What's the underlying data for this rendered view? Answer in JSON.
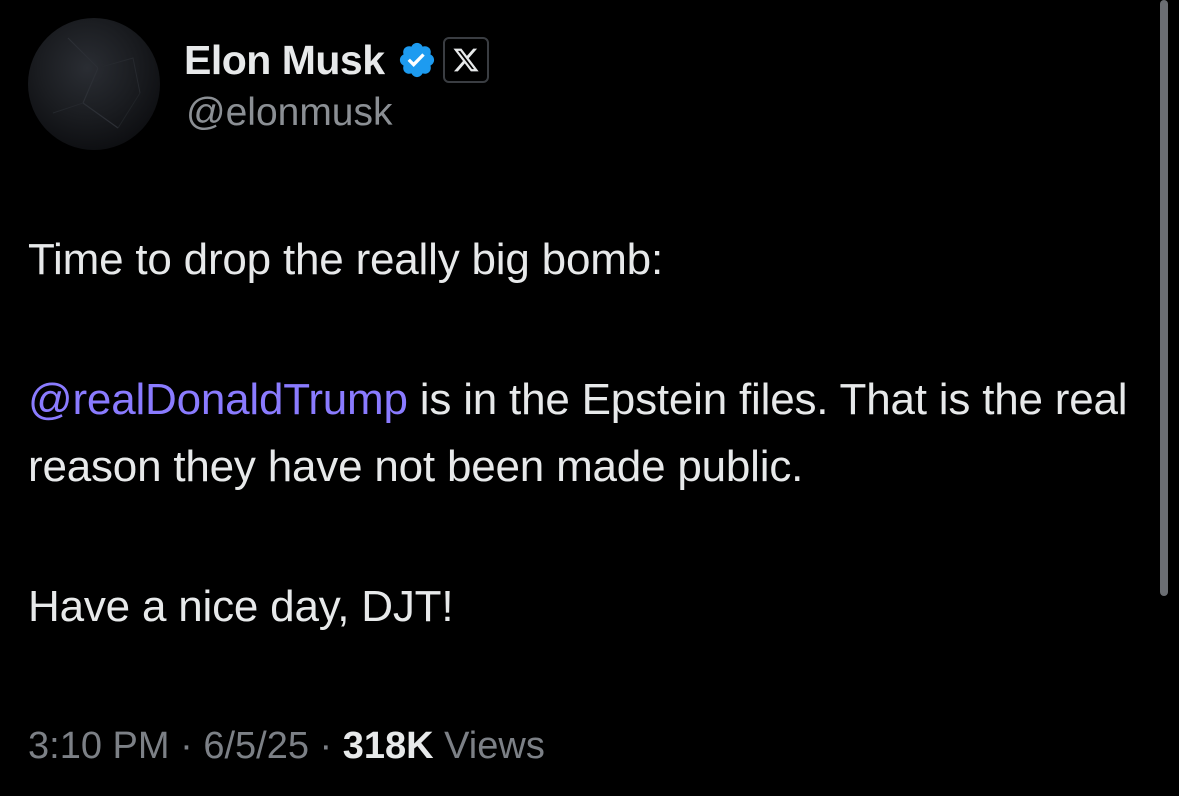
{
  "author": {
    "display_name": "Elon Musk",
    "handle": "@elonmusk",
    "verified_icon": "verified-badge-icon",
    "affiliation_icon": "x-logo-icon"
  },
  "tweet": {
    "line1": "Time to drop the really big bomb:",
    "mention": "@realDonaldTrump",
    "line2_rest": " is in the Epstein files. That is the real reason they have not been made public.",
    "line3": "Have a nice day, DJT!"
  },
  "meta": {
    "time": "3:10 PM",
    "separator": " · ",
    "date": "6/5/25",
    "views_count": "318K",
    "views_label": " Views"
  },
  "colors": {
    "background": "#000000",
    "text": "#e7e9ea",
    "muted": "#8b8f94",
    "mention": "#8a7bff",
    "verified": "#1d9bf0"
  }
}
